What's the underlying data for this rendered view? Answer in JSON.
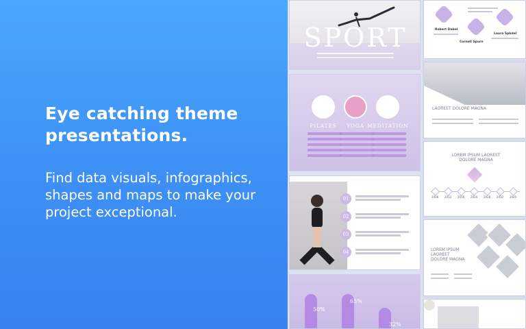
{
  "hero": {
    "headline": "Eye catching theme presentations.",
    "subline": "Find data visuals, infographics, shapes and maps to make your project exceptional."
  },
  "slides": {
    "sport": {
      "title": "SPORT"
    },
    "yoga": {
      "labels": [
        "PILATES",
        "YOGA",
        "MEDITATION"
      ]
    },
    "model": {
      "numbers": [
        "01",
        "02",
        "03",
        "04"
      ]
    },
    "percentages": {
      "values": [
        "50%",
        "65%",
        "32%"
      ]
    },
    "team": {
      "names": [
        "Robert Dabel",
        "Cornell Spurn",
        "Laura Spkdel"
      ]
    },
    "city": {
      "title": "LAOREET DOLORE MAGNA"
    },
    "timeline": {
      "title": "LOREM IPSUM LAOREET DOLORE MAGNA",
      "years": [
        "2008",
        "2012",
        "2016",
        "2024",
        "2028",
        "2032",
        "2040"
      ]
    },
    "collage": {
      "title": "LOREM IPSUM LAOREET DOLORE MAGNA"
    }
  },
  "colors": {
    "background_top": "#49a8fb",
    "background_bottom": "#3a82f2",
    "accent": "#b48ae4",
    "text": "#ffffff"
  }
}
